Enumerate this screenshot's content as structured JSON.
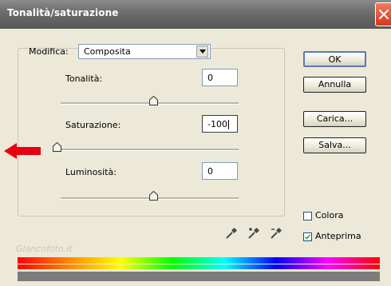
{
  "window": {
    "title": "Tonalità/saturazione"
  },
  "edit": {
    "label": "Modifica:",
    "value": "Composita"
  },
  "hue": {
    "label": "Tonalità:",
    "value": "0",
    "slider_fraction": 0.5
  },
  "saturation": {
    "label": "Saturazione:",
    "value": "-100",
    "slider_fraction": 0.0
  },
  "lightness": {
    "label": "Luminosità:",
    "value": "0",
    "slider_fraction": 0.5
  },
  "buttons": {
    "ok": "OK",
    "cancel": "Annulla",
    "load": "Carica...",
    "save": "Salva..."
  },
  "options": {
    "colorize": {
      "label": "Colora",
      "checked": false
    },
    "preview": {
      "label": "Anteprima",
      "checked": true
    }
  },
  "watermark": "Giancofoto.it",
  "icons": [
    "close-icon",
    "chevron-down-icon",
    "slider-thumb-icon",
    "red-arrow-icon",
    "eyedropper-icon",
    "eyedropper-plus-icon",
    "eyedropper-minus-icon",
    "checkmark-icon"
  ],
  "colors": {
    "title_bar": "#6e6e6e",
    "close_button": "#d3381c",
    "dialog_background": "#ece9d8",
    "ok_border": "#5c78b4",
    "arrow": "#e8000f"
  }
}
